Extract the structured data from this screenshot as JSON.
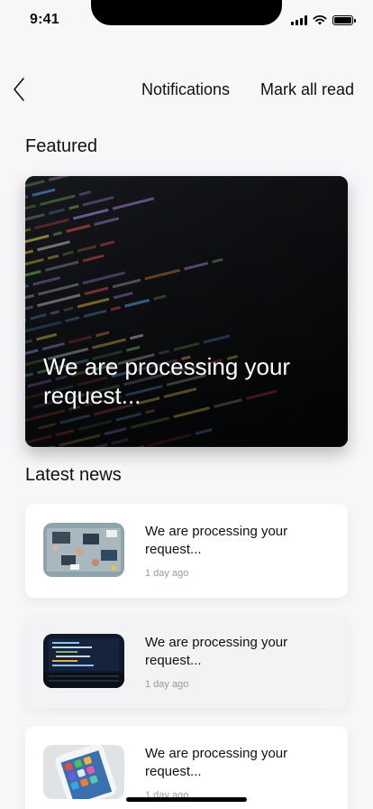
{
  "status_bar": {
    "time": "9:41"
  },
  "header": {
    "back_icon": "chevron-left-icon",
    "title": "Notifications",
    "mark_all_label": "Mark all read"
  },
  "featured": {
    "section_title": "Featured",
    "card_text": "We are processing your request..."
  },
  "latest": {
    "section_title": "Latest news",
    "items": [
      {
        "title": "We are processing your request...",
        "time": "1 day ago"
      },
      {
        "title": "We are processing your request...",
        "time": "1 day ago"
      },
      {
        "title": "We are processing your request...",
        "time": "1 day ago"
      }
    ]
  }
}
